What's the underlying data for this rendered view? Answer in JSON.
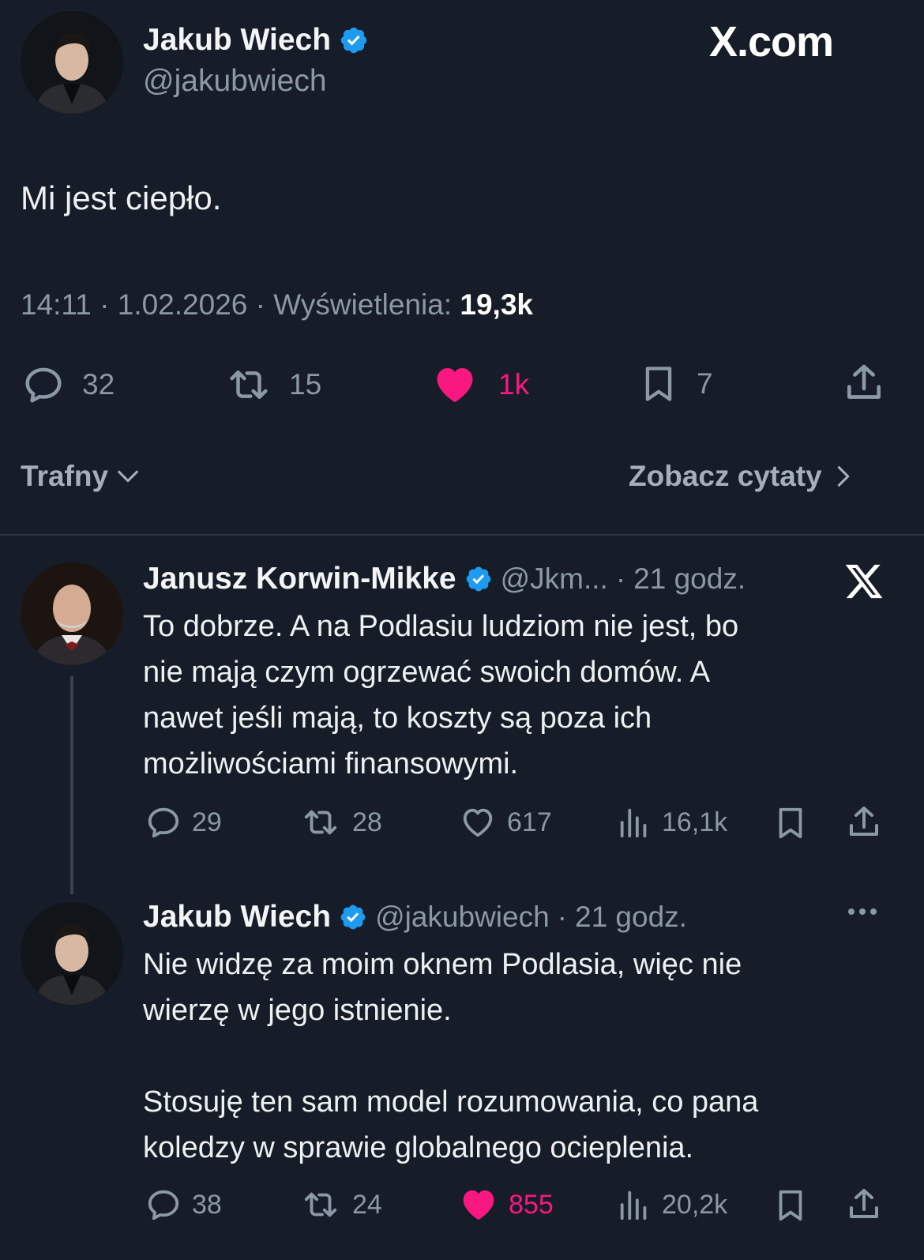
{
  "brand": {
    "watermark": "X.com"
  },
  "main_tweet": {
    "author": {
      "name": "Jakub Wiech",
      "handle": "@jakubwiech",
      "verified": true
    },
    "text": "Mi jest ciepło.",
    "meta": {
      "time": "14:11",
      "date": "1.02.2026",
      "views_label": "Wyświetlenia:",
      "views": "19,3k",
      "separator": "·"
    },
    "stats": {
      "replies": "32",
      "reposts": "15",
      "likes": "1k",
      "bookmarks": "7"
    },
    "colors": {
      "like_active": "#f91880"
    }
  },
  "sort_bar": {
    "sort_label": "Trafny",
    "quotes_label": "Zobacz cytaty"
  },
  "replies": [
    {
      "author": {
        "name": "Janusz Korwin-Mikke",
        "handle": "@Jkm...",
        "time": "21 godz.",
        "verified": true
      },
      "text_lines": [
        "To dobrze. A na Podlasiu ludziom nie jest, bo",
        "nie mają czym ogrzewać swoich domów. A",
        "nawet jeśli mają, to koszty są poza ich",
        "możliwościami finansowymi."
      ],
      "stats": {
        "replies": "29",
        "reposts": "28",
        "likes": "617",
        "views": "16,1k"
      }
    },
    {
      "author": {
        "name": "Jakub Wiech",
        "handle": "@jakubwiech",
        "time": "21 godz.",
        "verified": true
      },
      "text_lines": [
        "Nie widzę za moim oknem Podlasia, więc nie",
        "wierzę w jego istnienie.",
        "",
        "Stosuję ten sam model rozumowania, co pana",
        "koledzy w sprawie globalnego ocieplenia."
      ],
      "stats": {
        "replies": "38",
        "reposts": "24",
        "likes": "855",
        "views": "20,2k"
      }
    }
  ],
  "icons": [
    "verified-badge-icon",
    "x-logo-icon",
    "reply-icon",
    "repost-icon",
    "heart-icon",
    "bookmark-icon",
    "share-icon",
    "views-icon",
    "chevron-down-icon",
    "chevron-right-icon",
    "more-icon"
  ],
  "theme": {
    "background": "#161c28",
    "text": "#e7e9ea",
    "muted": "#8b98a5",
    "verified": "#1d9bf0",
    "like": "#f91880"
  }
}
